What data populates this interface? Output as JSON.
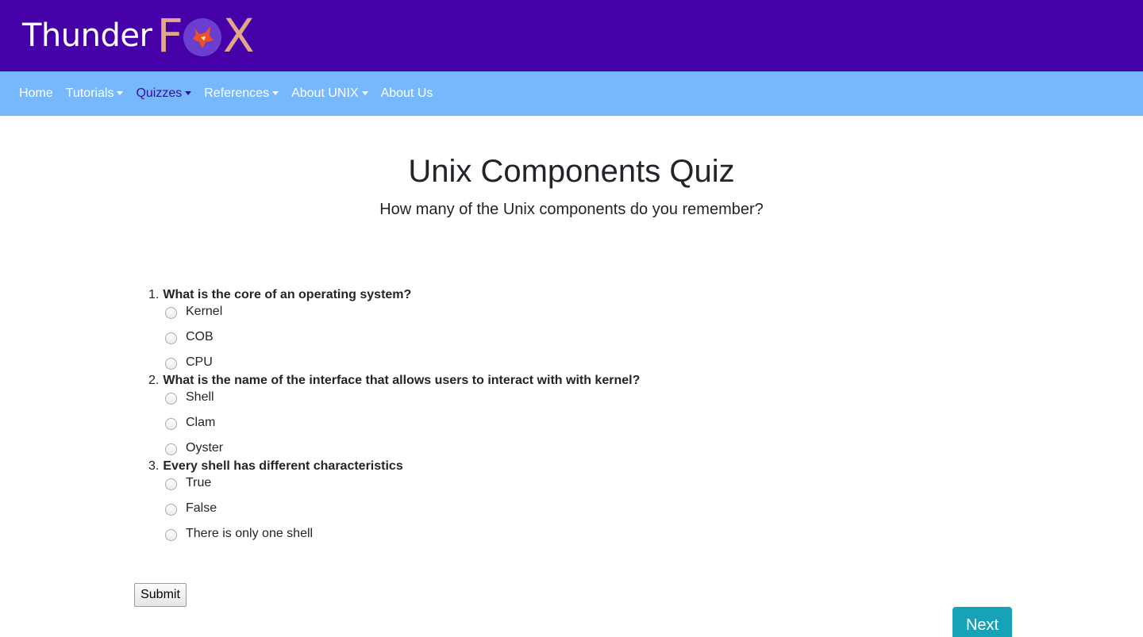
{
  "brand": {
    "thunder": "Thunder",
    "fox_f": "F",
    "fox_x": "X"
  },
  "nav": {
    "items": [
      {
        "label": "Home",
        "dropdown": false,
        "active": false
      },
      {
        "label": "Tutorials",
        "dropdown": true,
        "active": false
      },
      {
        "label": "Quizzes",
        "dropdown": true,
        "active": true
      },
      {
        "label": "References",
        "dropdown": true,
        "active": false
      },
      {
        "label": "About UNIX",
        "dropdown": true,
        "active": false
      },
      {
        "label": "About Us",
        "dropdown": false,
        "active": false
      }
    ]
  },
  "page": {
    "title": "Unix Components Quiz",
    "subtitle": "How many of the Unix components do you remember?"
  },
  "quiz": {
    "questions": [
      {
        "number": "1.",
        "text": "What is the core of an operating system?",
        "options": [
          "Kernel",
          "COB",
          "CPU"
        ]
      },
      {
        "number": "2.",
        "text": "What is the name of the interface that allows users to interact with with kernel?",
        "options": [
          "Shell",
          "Clam",
          "Oyster"
        ]
      },
      {
        "number": "3.",
        "text": "Every shell has different characteristics",
        "options": [
          "True",
          "False",
          "There is only one shell"
        ]
      }
    ]
  },
  "buttons": {
    "submit": "Submit",
    "next": "Next"
  },
  "colors": {
    "topbar": "#4500a8",
    "navbar": "#77b8fd",
    "next_button": "#17a2b8",
    "logo_fox": "#e2a788"
  }
}
